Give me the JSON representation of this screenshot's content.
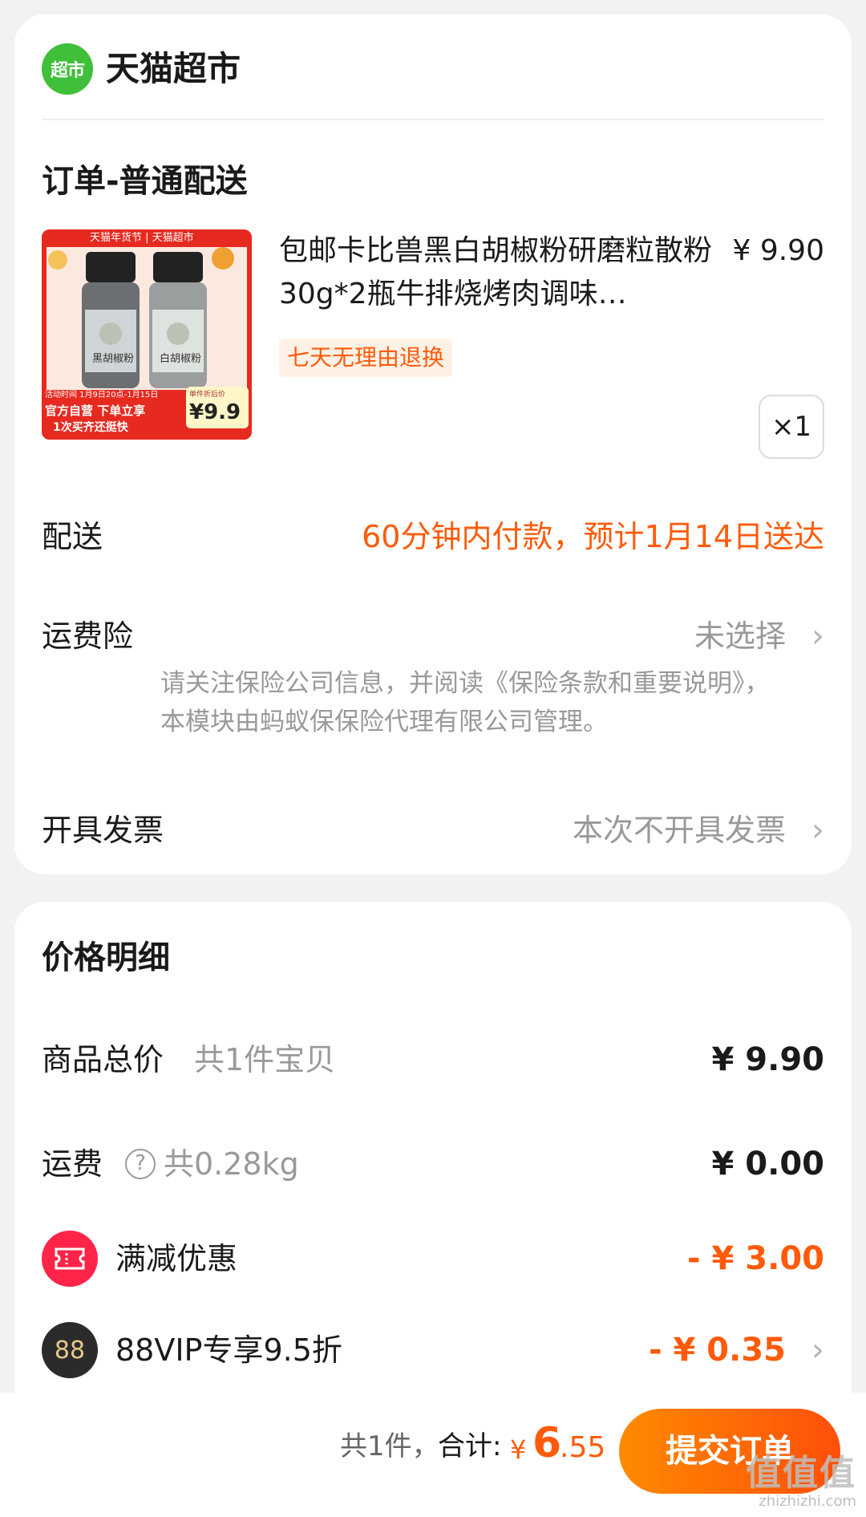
{
  "store": {
    "logo_text": "超市",
    "name": "天猫超市"
  },
  "order": {
    "section_title": "订单-普通配送",
    "product": {
      "image_banner": "天猫年货节 | 天猫超市",
      "image_jar_left": "黑胡椒粉",
      "image_jar_right": "白胡椒粉",
      "image_activity": "活动时间  1月9日20点-1月15日",
      "image_badge_1": "官方自营  下单立享",
      "image_badge_2": "1次买齐还挺快",
      "image_unit_label": "单件折后价",
      "image_unit_price": "¥9.9",
      "title": "包邮卡比兽黑白胡椒粉研磨粒散粉30g*2瓶牛排烧烤肉调味…",
      "price": "¥ 9.90",
      "return_tag": "七天无理由退换",
      "quantity": "×1"
    },
    "delivery": {
      "label": "配送",
      "value": "60分钟内付款，预计1月14日送达"
    },
    "insurance": {
      "label": "运费险",
      "value": "未选择",
      "note": "请关注保险公司信息，并阅读《保险条款和重要说明》，本模块由蚂蚁保保险代理有限公司管理。"
    },
    "invoice": {
      "label": "开具发票",
      "value": "本次不开具发票"
    }
  },
  "price_detail": {
    "title": "价格明细",
    "goods_total": {
      "label": "商品总价",
      "sub": "共1件宝贝",
      "value": "¥ 9.90"
    },
    "shipping": {
      "label": "运费",
      "help": "?",
      "sub": "共0.28kg",
      "value": "¥ 0.00"
    },
    "full_reduction": {
      "label": "满减优惠",
      "value": "- ¥ 3.00"
    },
    "vip": {
      "icon_text": "88",
      "label": "88VIP专享9.5折",
      "value": "- ¥ 0.35"
    }
  },
  "bottom_bar": {
    "count_text": "共1件，",
    "total_label": "合计:",
    "currency": "¥",
    "total_int": "6",
    "total_dec": ".55",
    "submit_label": "提交订单"
  },
  "watermark": {
    "big": "值值值",
    "small": "zhizhizhi.com"
  },
  "colors": {
    "accent": "#ff5b0a",
    "store_green": "#3fbf3a",
    "reduction_red": "#ff2448",
    "vip_dark": "#2b2b2b"
  },
  "icons": [
    "store-logo",
    "chevron-right-icon",
    "help-icon",
    "coupon-icon",
    "vip-88-icon"
  ]
}
